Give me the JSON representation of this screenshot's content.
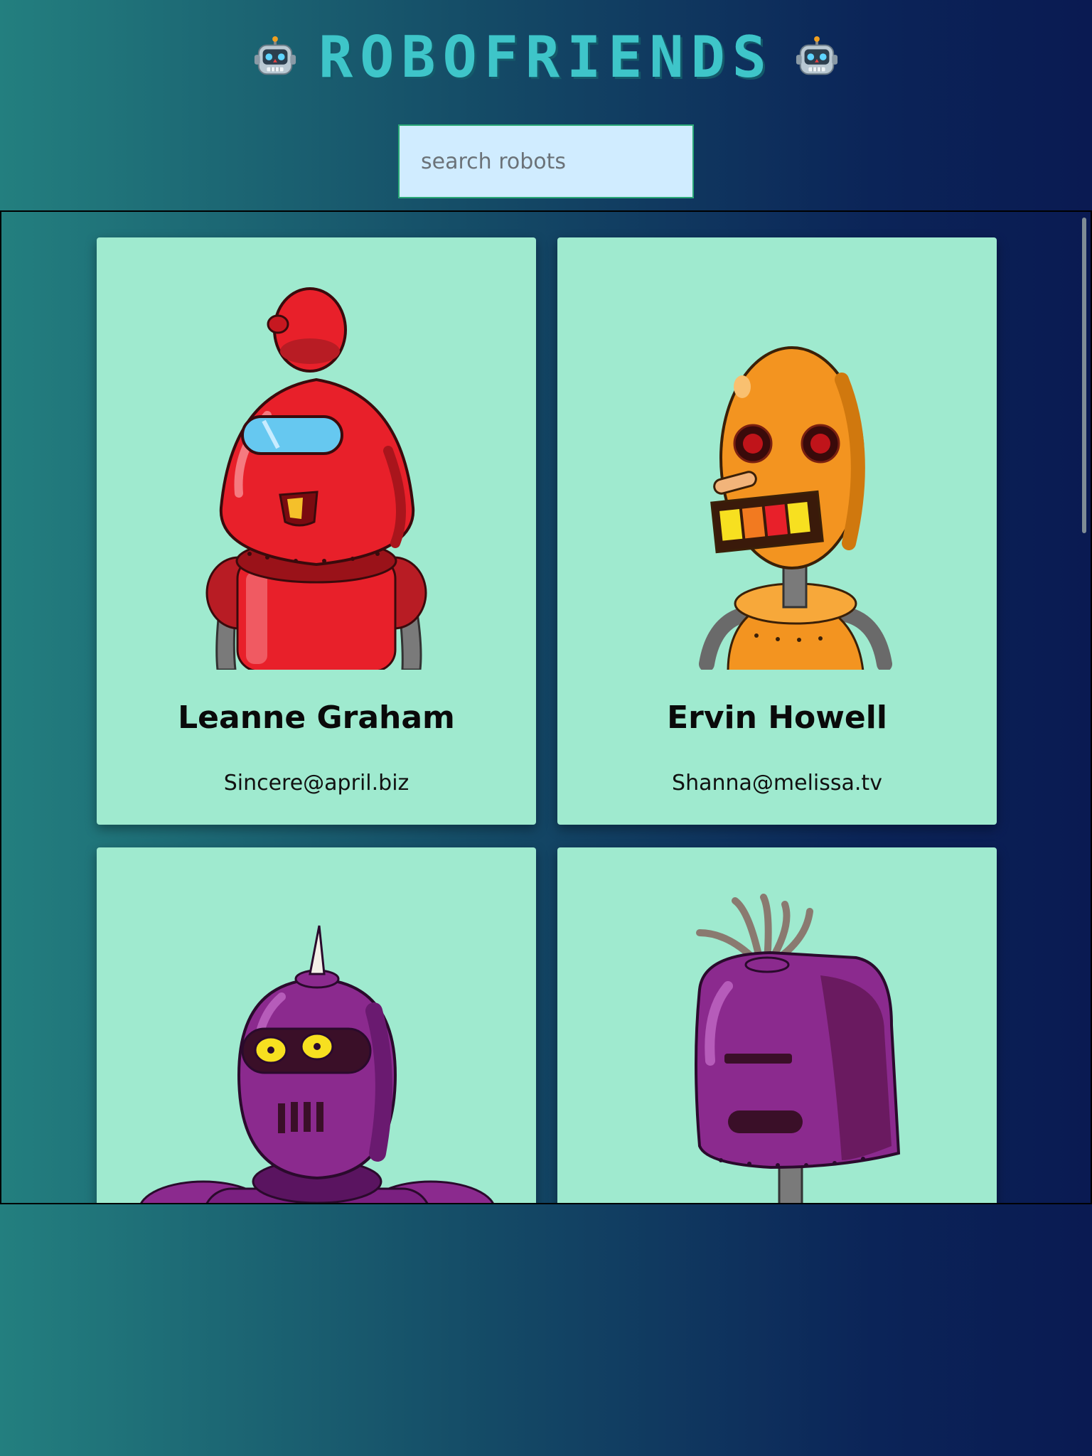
{
  "header": {
    "title": "ROBOFRIENDS",
    "left_icon": "robot-face-icon",
    "right_icon": "robot-face-icon"
  },
  "search": {
    "placeholder": "search robots",
    "value": ""
  },
  "robots": [
    {
      "name": "Leanne Graham",
      "email": "Sincere@april.biz",
      "color": "#e8202a"
    },
    {
      "name": "Ervin Howell",
      "email": "Shanna@melissa.tv",
      "color": "#f39420"
    },
    {
      "name": "",
      "email": "",
      "color": "#8b2a8e"
    },
    {
      "name": "",
      "email": "",
      "color": "#8b2a8e"
    }
  ],
  "colors": {
    "title": "#3ec5c9",
    "card_background": "#9feacf",
    "search_background": "#d0ecff"
  }
}
